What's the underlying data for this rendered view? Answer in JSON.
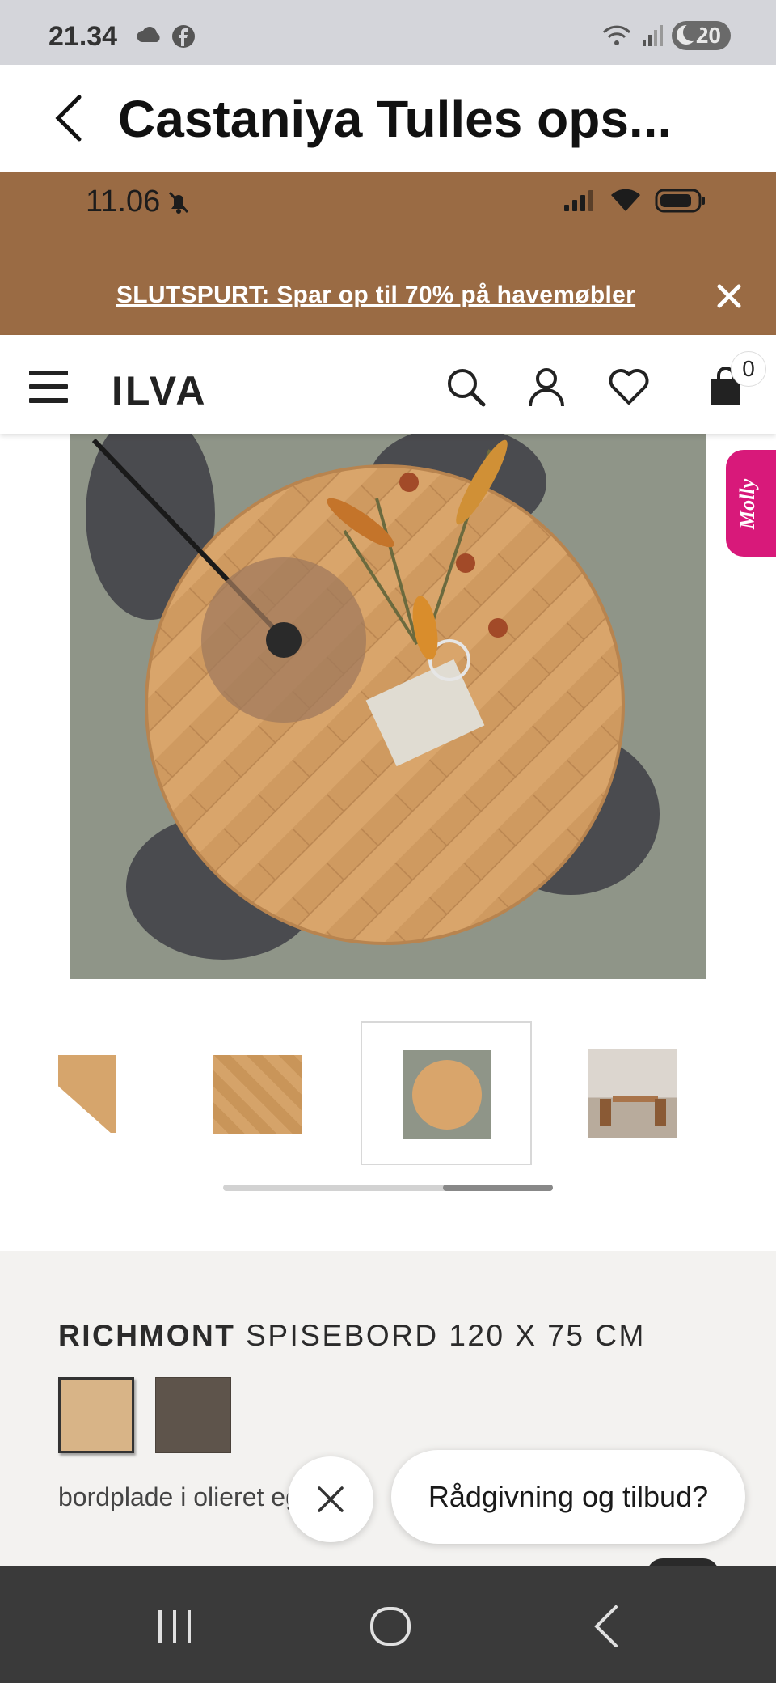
{
  "os_status": {
    "time": "21.34",
    "battery": "20"
  },
  "app_header": {
    "title": "Castaniya Tulles ops..."
  },
  "inner_status": {
    "time": "11.06"
  },
  "promo": {
    "text": "SLUTSPURT: Spar op til 70% på havemøbler"
  },
  "store_nav": {
    "logo": "ILVA",
    "cart_count": "0"
  },
  "molly": {
    "label": "Molly"
  },
  "product": {
    "brand": "RICHMONT",
    "title_rest": " SPISEBORD 120 X 75 CM",
    "description": "bordplade i olieret eg, og",
    "swatch_colors": [
      "#d8b487",
      "#5e544b"
    ]
  },
  "chat": {
    "prompt": "Rådgivning og tilbud?"
  },
  "colors": {
    "promo_bg": "#9a6b44",
    "molly_bg": "#d8197a",
    "info_bg": "#f3f2f0",
    "sys_nav_bg": "#3a3a3a"
  }
}
